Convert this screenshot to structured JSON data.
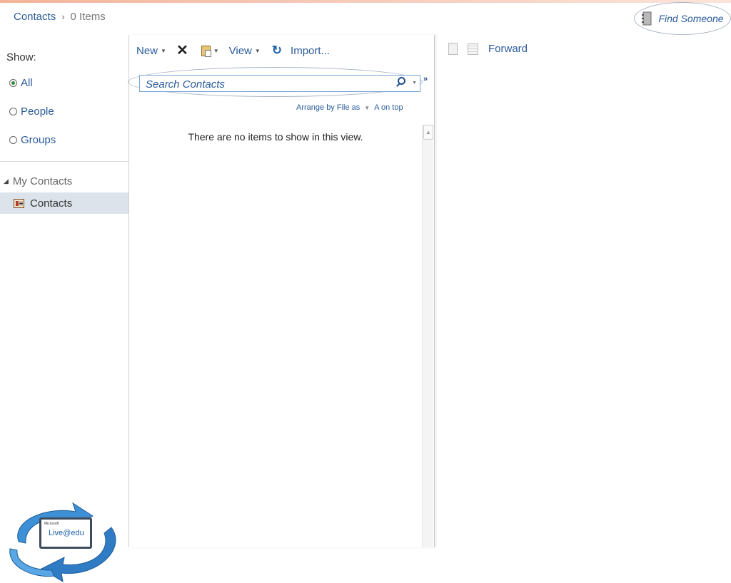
{
  "breadcrumb": {
    "folder": "Contacts",
    "separator": "›",
    "count": "0 Items"
  },
  "find_someone": {
    "label": "Find Someone"
  },
  "show": {
    "label": "Show:",
    "options": [
      {
        "label": "All",
        "checked": true
      },
      {
        "label": "People",
        "checked": false
      },
      {
        "label": "Groups",
        "checked": false
      }
    ]
  },
  "folders": {
    "group": "My Contacts",
    "selected": "Contacts"
  },
  "toolbar": {
    "new_label": "New",
    "view_label": "View",
    "import_label": "Import..."
  },
  "search": {
    "placeholder": "Search Contacts"
  },
  "arrange": {
    "by_label": "Arrange by File as",
    "order_label": "A on top"
  },
  "list": {
    "empty_message": "There are no items to show in this view."
  },
  "reading_toolbar": {
    "forward_label": "Forward"
  },
  "logo": {
    "small_text": "Microsoft",
    "text": "Live@edu"
  },
  "colors": {
    "link": "#2a5b9b",
    "selection": "#dde3ea",
    "accent_green": "#2e8b3a"
  }
}
